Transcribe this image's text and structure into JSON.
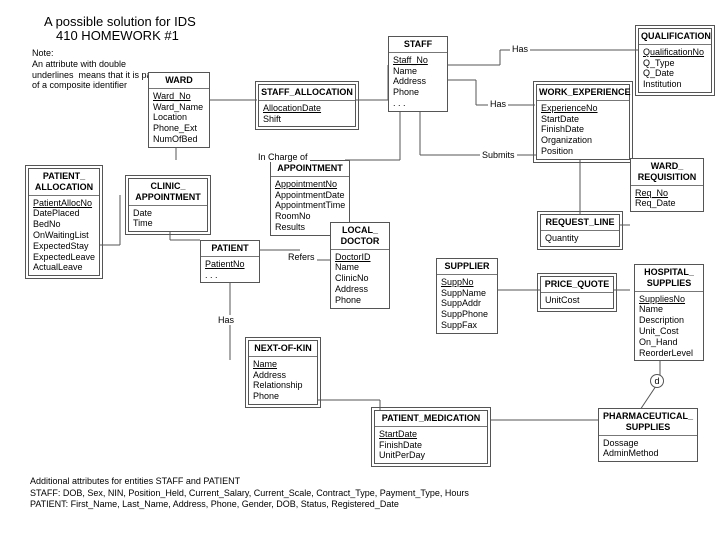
{
  "title_line1": "A possible solution for IDS",
  "title_line2": "410 HOMEWORK #1",
  "note": "Note:\nAn attribute with double\nunderlines  means that it is part\nof a composite identifier",
  "entities": {
    "ward": {
      "name": "WARD",
      "attrs": [
        "Ward_No",
        "Ward_Name",
        "Location",
        "Phone_Ext",
        "NumOfBed"
      ],
      "keys": [
        "Ward_No"
      ]
    },
    "staff_allocation": {
      "name": "STAFF_ALLOCATION",
      "attrs": [
        "AllocationDate",
        "Shift"
      ],
      "keys": [
        "AllocationDate"
      ]
    },
    "staff": {
      "name": "STAFF",
      "attrs": [
        "Staff_No",
        "Name",
        "Address",
        "Phone",
        ". . ."
      ],
      "keys": [
        "Staff_No"
      ]
    },
    "qualification": {
      "name": "QUALIFICATION",
      "attrs": [
        "QualificationNo",
        "Q_Type",
        "Q_Date",
        "Institution"
      ],
      "keys": [
        "QualificationNo"
      ]
    },
    "work_experience": {
      "name": "WORK_EXPERIENCE",
      "attrs": [
        "ExperienceNo",
        "StartDate",
        "FinishDate",
        "Organization",
        "Position"
      ],
      "keys": [
        "ExperienceNo"
      ]
    },
    "patient_allocation": {
      "name": "PATIENT_\nALLOCATION",
      "attrs": [
        "PatientAllocNo",
        "DatePlaced",
        "BedNo",
        "OnWaitingList",
        "ExpectedStay",
        "ExpectedLeave",
        "ActualLeave"
      ],
      "keys": [
        "PatientAllocNo"
      ]
    },
    "clinic_appointment": {
      "name": "CLINIC_\nAPPOINTMENT",
      "attrs": [
        "Date",
        "Time"
      ],
      "keys": []
    },
    "appointment": {
      "name": "APPOINTMENT",
      "attrs": [
        "AppointmentNo",
        "AppointmentDate",
        "AppointmentTime",
        "RoomNo",
        "Results"
      ],
      "keys": [
        "AppointmentNo"
      ]
    },
    "patient": {
      "name": "PATIENT",
      "attrs": [
        "PatientNo",
        ". . ."
      ],
      "keys": [
        "PatientNo"
      ]
    },
    "local_doctor": {
      "name": "LOCAL_\nDOCTOR",
      "attrs": [
        "DoctorID",
        "Name",
        "ClinicNo",
        "Address",
        "Phone"
      ],
      "keys": [
        "DoctorID"
      ]
    },
    "supplier": {
      "name": "SUPPLIER",
      "attrs": [
        "SuppNo",
        "SuppName",
        "SuppAddr",
        "SuppPhone",
        "SuppFax"
      ],
      "keys": [
        "SuppNo"
      ]
    },
    "price_quote": {
      "name": "PRICE_QUOTE",
      "attrs": [
        "UnitCost"
      ],
      "keys": []
    },
    "hospital_supplies": {
      "name": "HOSPITAL_\nSUPPLIES",
      "attrs": [
        "SuppliesNo",
        "Name",
        "Description",
        "Unit_Cost",
        "On_Hand",
        "ReorderLevel"
      ],
      "keys": [
        "SuppliesNo"
      ]
    },
    "ward_requisition": {
      "name": "WARD_\nREQUISITION",
      "attrs": [
        "Req_No",
        "Req_Date"
      ],
      "keys": [
        "Req_No"
      ]
    },
    "request_line": {
      "name": "REQUEST_LINE",
      "attrs": [
        "Quantity"
      ],
      "keys": []
    },
    "next_of_kin": {
      "name": "NEXT-OF-KIN",
      "attrs": [
        "Name",
        "Address",
        "Relationship",
        "Phone"
      ],
      "keys": [
        "Name"
      ]
    },
    "patient_medication": {
      "name": "PATIENT_MEDICATION",
      "attrs": [
        "StartDate",
        "FinishDate",
        "UnitPerDay"
      ],
      "keys": [
        "StartDate"
      ]
    },
    "pharmaceutical_supplies": {
      "name": "PHARMACEUTICAL_\nSUPPLIES",
      "attrs": [
        "Dossage",
        "AdminMethod"
      ],
      "keys": []
    }
  },
  "labels": {
    "has1": "Has",
    "has2": "Has",
    "has3": "Has",
    "submits": "Submits",
    "in_charge": "In Charge of",
    "refers": "Refers",
    "d": "d"
  },
  "footer": {
    "line1": "Additional attributes for entities STAFF and PATIENT",
    "line2": "STAFF: DOB, Sex, NIN, Position_Held, Current_Salary, Current_Scale, Contract_Type, Payment_Type, Hours",
    "line3": "PATIENT: First_Name, Last_Name, Address, Phone, Gender, DOB, Status, Registered_Date"
  }
}
